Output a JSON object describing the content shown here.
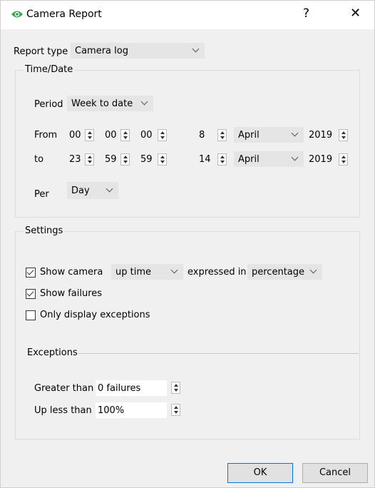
{
  "window": {
    "title": "Camera Report",
    "help": "?",
    "close": "✕"
  },
  "report_type": {
    "label": "Report type",
    "value": "Camera log"
  },
  "time_date": {
    "group_label": "Time/Date",
    "period": {
      "label": "Period",
      "value": "Week to date"
    },
    "from": {
      "label": "From",
      "hour": "00",
      "minute": "00",
      "second": "00",
      "day": "8",
      "month": "April",
      "year": "2019"
    },
    "to": {
      "label": "to",
      "hour": "23",
      "minute": "59",
      "second": "59",
      "day": "14",
      "month": "April",
      "year": "2019"
    },
    "per": {
      "label": "Per",
      "value": "Day"
    }
  },
  "settings": {
    "group_label": "Settings",
    "show_camera": {
      "label": "Show camera",
      "checked": true,
      "metric": "up time",
      "expressed_label": "expressed in",
      "unit": "percentage"
    },
    "show_failures": {
      "label": "Show failures",
      "checked": true
    },
    "only_exceptions": {
      "label": "Only display exceptions",
      "checked": false
    },
    "exceptions": {
      "label": "Exceptions",
      "greater_than": {
        "label": "Greater than",
        "value": "0 failures"
      },
      "up_less_than": {
        "label": "Up less than",
        "value": "100%"
      }
    }
  },
  "buttons": {
    "ok": "OK",
    "cancel": "Cancel"
  }
}
